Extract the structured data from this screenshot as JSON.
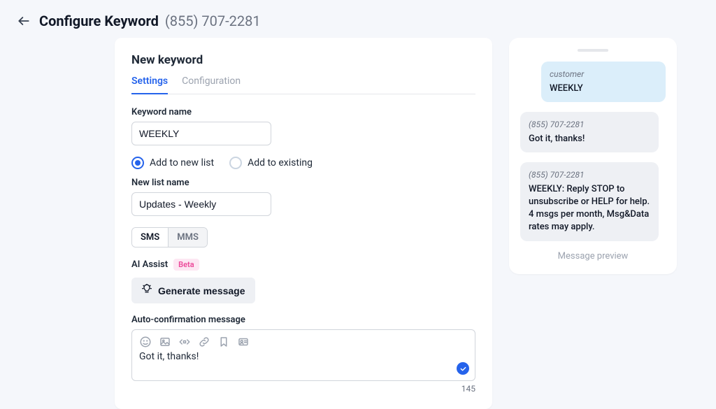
{
  "header": {
    "title": "Configure Keyword",
    "phone": "(855) 707-2281"
  },
  "card": {
    "title": "New keyword",
    "tabs": {
      "settings": "Settings",
      "configuration": "Configuration"
    },
    "keywordName": {
      "label": "Keyword name",
      "value": "WEEKLY"
    },
    "listMode": {
      "addNew": "Add to new list",
      "addExisting": "Add to existing"
    },
    "newList": {
      "label": "New list name",
      "value": "Updates - Weekly"
    },
    "channel": {
      "sms": "SMS",
      "mms": "MMS"
    },
    "aiAssist": {
      "label": "AI Assist",
      "badge": "Beta",
      "button": "Generate message"
    },
    "autoConfirm": {
      "label": "Auto-confirmation message",
      "value": "Got it, thanks!",
      "charCount": "145"
    }
  },
  "preview": {
    "customer": {
      "sender": "customer",
      "text": "WEEKLY"
    },
    "reply1": {
      "sender": "(855) 707-2281",
      "text": "Got it, thanks!"
    },
    "reply2": {
      "sender": "(855) 707-2281",
      "text": "WEEKLY: Reply STOP to unsubscribe or HELP for help. 4 msgs per month, Msg&Data rates may apply."
    },
    "label": "Message preview"
  }
}
